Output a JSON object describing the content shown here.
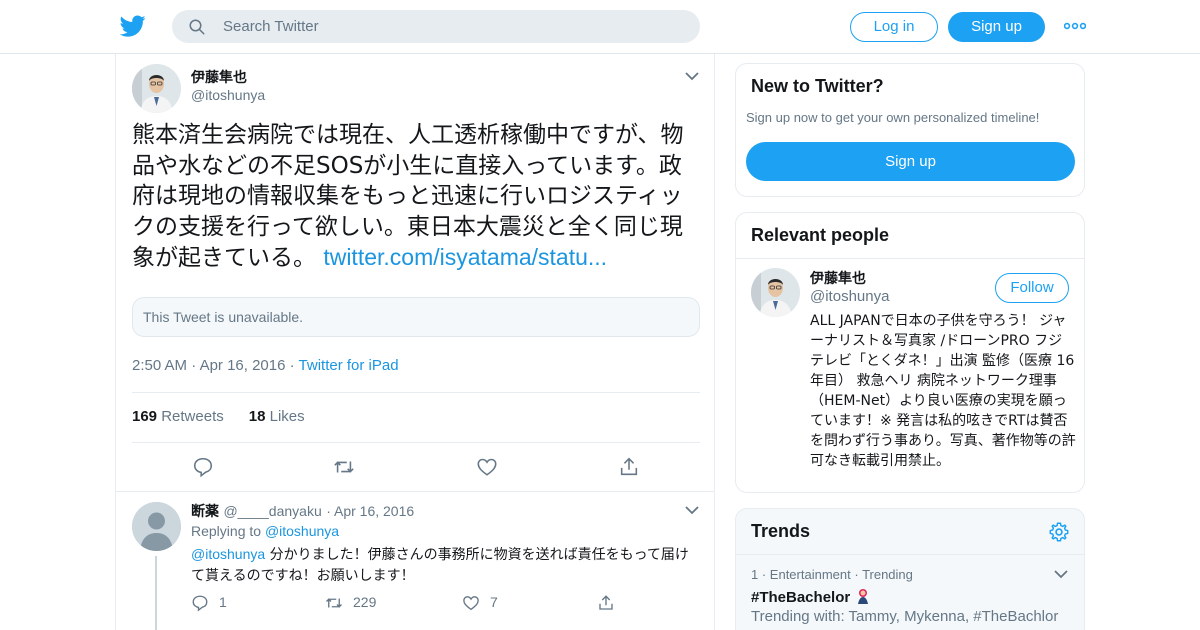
{
  "colors": {
    "accent": "#1da1f2",
    "link": "#1b95e0",
    "muted": "#657786",
    "border": "#e6ecf0",
    "text": "#14171a"
  },
  "icons": [
    "twitter-logo-icon",
    "search-icon",
    "more-dots-icon",
    "chevron-down-icon",
    "reply-icon",
    "retweet-icon",
    "like-icon",
    "share-icon",
    "gear-icon"
  ],
  "header": {
    "search_placeholder": "Search Twitter",
    "login_label": "Log in",
    "signup_label": "Sign up"
  },
  "tweet": {
    "author_name": "伊藤隼也",
    "author_handle": "@itoshunya",
    "text": "熊本済生会病院では現在、人工透析稼働中ですが、物品や水などの不足SOSが小生に直接入っています。政府は現地の情報収集をもっと迅速に行いロジスティックの支援を行って欲しい。東日本大震災と全く同じ現象が起きている。",
    "link": "twitter.com/isyatama/statu...",
    "unavailable": "This Tweet is unavailable.",
    "time": "2:50 AM",
    "date": "Apr 16, 2016",
    "source": "Twitter for iPad",
    "retweets_count": "169",
    "retweets_label": "Retweets",
    "likes_count": "18",
    "likes_label": "Likes"
  },
  "reply": {
    "author_name": "断薬",
    "author_handle": "@____danyaku",
    "date": "Apr 16, 2016",
    "replying_label": "Replying to",
    "replying_to": "@itoshunya",
    "mention": "@itoshunya",
    "text": " 分かりました！伊藤さんの事務所に物資を送れば責任をもって届けて貰えるのですね！お願いします！",
    "reply_count": "1",
    "retweet_count": "229",
    "like_count": "7"
  },
  "sidebar": {
    "new": {
      "title": "New to Twitter?",
      "subtitle": "Sign up now to get your own personalized timeline!",
      "button": "Sign up"
    },
    "relevant": {
      "title": "Relevant people",
      "name": "伊藤隼也",
      "handle": "@itoshunya",
      "follow": "Follow",
      "bio": "ALL JAPANで日本の子供を守ろう！ ジャーナリスト＆写真家 /ドローンPRO フジテレビ「とくダネ！」出演 監修（医療 16年目） 救急ヘリ 病院ネットワーク理事（HEM-Net）より良い医療の実現を願っています！※ 発言は私的呟きでRTは賛否を問わず行う事あり。写真、著作物等の許可なき転載引用禁止。"
    },
    "trends": {
      "title": "Trends",
      "items": [
        {
          "rank": "1",
          "category": "Entertainment",
          "status": "Trending",
          "name": "#TheBachelor",
          "trending_with": "Trending with: Tammy, Mykenna, #TheBachlor"
        }
      ]
    }
  }
}
